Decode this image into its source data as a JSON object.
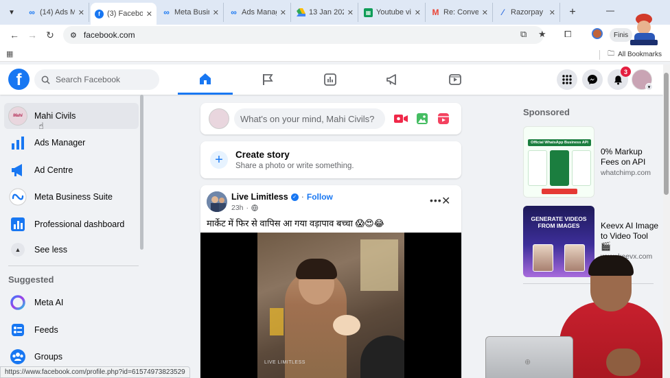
{
  "browser": {
    "tabs": [
      {
        "label": "(14) Ads M",
        "icon": "meta-icon",
        "active": false
      },
      {
        "label": "(3) Facebo",
        "icon": "facebook-icon",
        "active": true
      },
      {
        "label": "Meta Busin",
        "icon": "meta-icon",
        "active": false
      },
      {
        "label": "Ads Manag",
        "icon": "meta-icon",
        "active": false
      },
      {
        "label": "13 Jan 202",
        "icon": "drive-icon",
        "active": false
      },
      {
        "label": "Youtube vi",
        "icon": "sheets-icon",
        "active": false
      },
      {
        "label": "Re: Conve",
        "icon": "gmail-icon",
        "active": false
      },
      {
        "label": "Razorpay |",
        "icon": "razorpay-icon",
        "active": false
      }
    ],
    "url": "facebook.com",
    "finish_label": "Finis",
    "all_bookmarks": "All Bookmarks",
    "status_url": "https://www.facebook.com/profile.php?id=61574973823529"
  },
  "header": {
    "logo": "f",
    "search_placeholder": "Search Facebook",
    "notification_count": "3",
    "nav_tabs": [
      "home-icon",
      "pages-flag-icon",
      "insights-icon",
      "ads-megaphone-icon",
      "video-icon"
    ],
    "active_tab": "home-icon"
  },
  "sidebar": {
    "items": [
      {
        "label": "Mahi Civils",
        "icon": "page-avatar"
      },
      {
        "label": "Ads Manager",
        "icon": "ads-manager-icon"
      },
      {
        "label": "Ad Centre",
        "icon": "ad-centre-icon"
      },
      {
        "label": "Meta Business Suite",
        "icon": "business-suite-icon"
      },
      {
        "label": "Professional dashboard",
        "icon": "dashboard-icon"
      }
    ],
    "see_less": "See less",
    "suggested_heading": "Suggested",
    "suggested": [
      {
        "label": "Meta AI",
        "icon": "meta-ai-icon"
      },
      {
        "label": "Feeds",
        "icon": "feeds-icon"
      },
      {
        "label": "Groups",
        "icon": "groups-icon"
      }
    ],
    "avatar_text": "Mahi Civils"
  },
  "composer": {
    "placeholder": "What's on your mind, Mahi Civils?"
  },
  "story": {
    "title": "Create story",
    "subtitle": "Share a photo or write something."
  },
  "post": {
    "author": "Live Limitless",
    "follow": "Follow",
    "time": "23h",
    "text": "मार्केट में फिर से वापिस आ गया वड़ापाव बच्चा 😱😍😂",
    "watermark": "LIVE LIMITLESS"
  },
  "sponsored": {
    "heading": "Sponsored",
    "ads": [
      {
        "title": "0% Markup Fees on API",
        "domain": "whatchimp.com",
        "image_text": "Official WhatsApp Business API"
      },
      {
        "title": "Keevx AI Image to Video Tool 🎬",
        "domain": "www.keevx.com",
        "image_text": "GENERATE VIDEOS FROM IMAGES"
      }
    ]
  },
  "colors": {
    "facebook_blue": "#1877f2",
    "notification_red": "#e41e3f",
    "page_bg": "#f0f2f5"
  }
}
